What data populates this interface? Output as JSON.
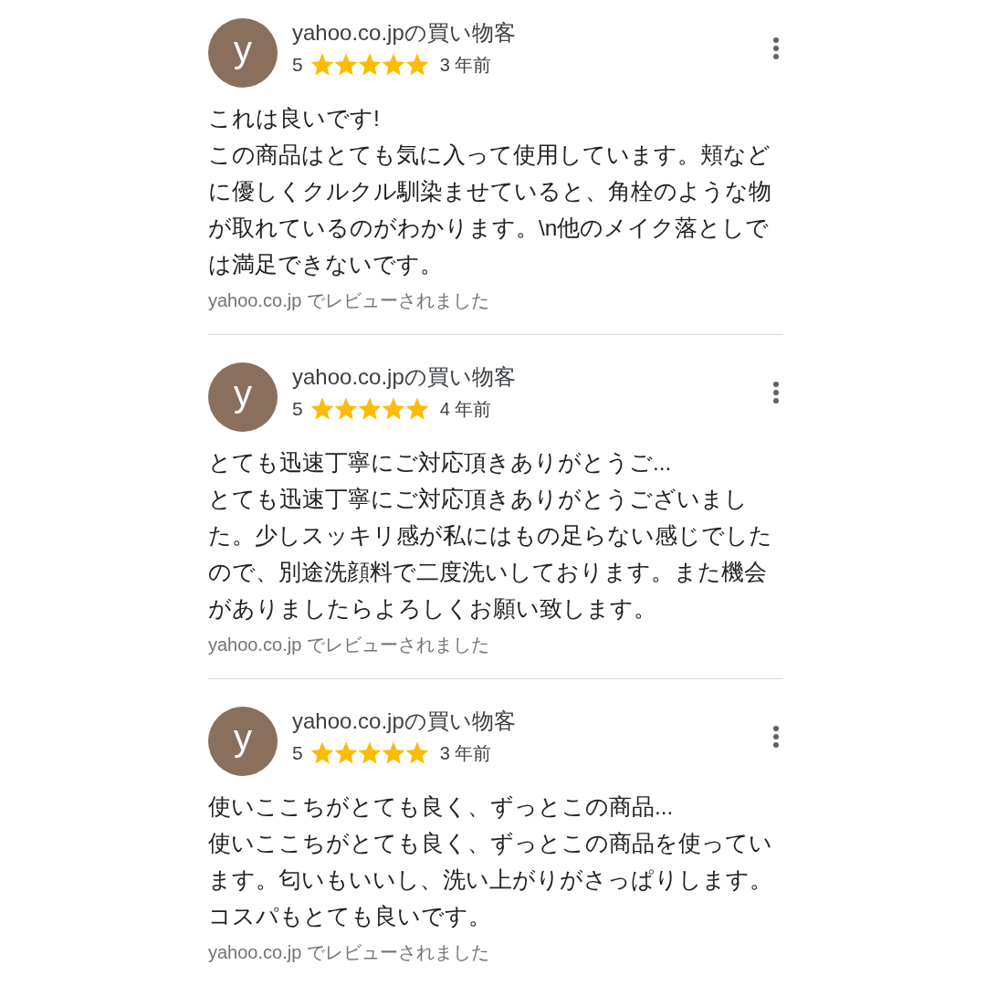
{
  "reviews": [
    {
      "avatar": "y",
      "author": "yahoo.co.jpの買い物客",
      "rating": "5",
      "stars": 5,
      "age": "3 年前",
      "title": "これは良いです!",
      "body": "この商品はとても気に入って使用しています。頬などに優しくクルクル馴染ませていると、角栓のような物が取れているのがわかります。\\n他のメイク落としでは満足できないです。",
      "source": "yahoo.co.jp でレビューされました"
    },
    {
      "avatar": "y",
      "author": "yahoo.co.jpの買い物客",
      "rating": "5",
      "stars": 5,
      "age": "4 年前",
      "title": "とても迅速丁寧にご対応頂きありがとうご...",
      "body": "とても迅速丁寧にご対応頂きありがとうございました。少しスッキリ感が私にはもの足らない感じでしたので、別途洗顔料で二度洗いしております。また機会がありましたらよろしくお願い致します。",
      "source": "yahoo.co.jp でレビューされました"
    },
    {
      "avatar": "y",
      "author": "yahoo.co.jpの買い物客",
      "rating": "5",
      "stars": 5,
      "age": "3 年前",
      "title": "使いここちがとても良く、ずっとこの商品...",
      "body": "使いここちがとても良く、ずっとこの商品を使っています。匂いもいいし、洗い上がりがさっぱりします。コスパもとても良いです。",
      "source": "yahoo.co.jp でレビューされました"
    }
  ]
}
